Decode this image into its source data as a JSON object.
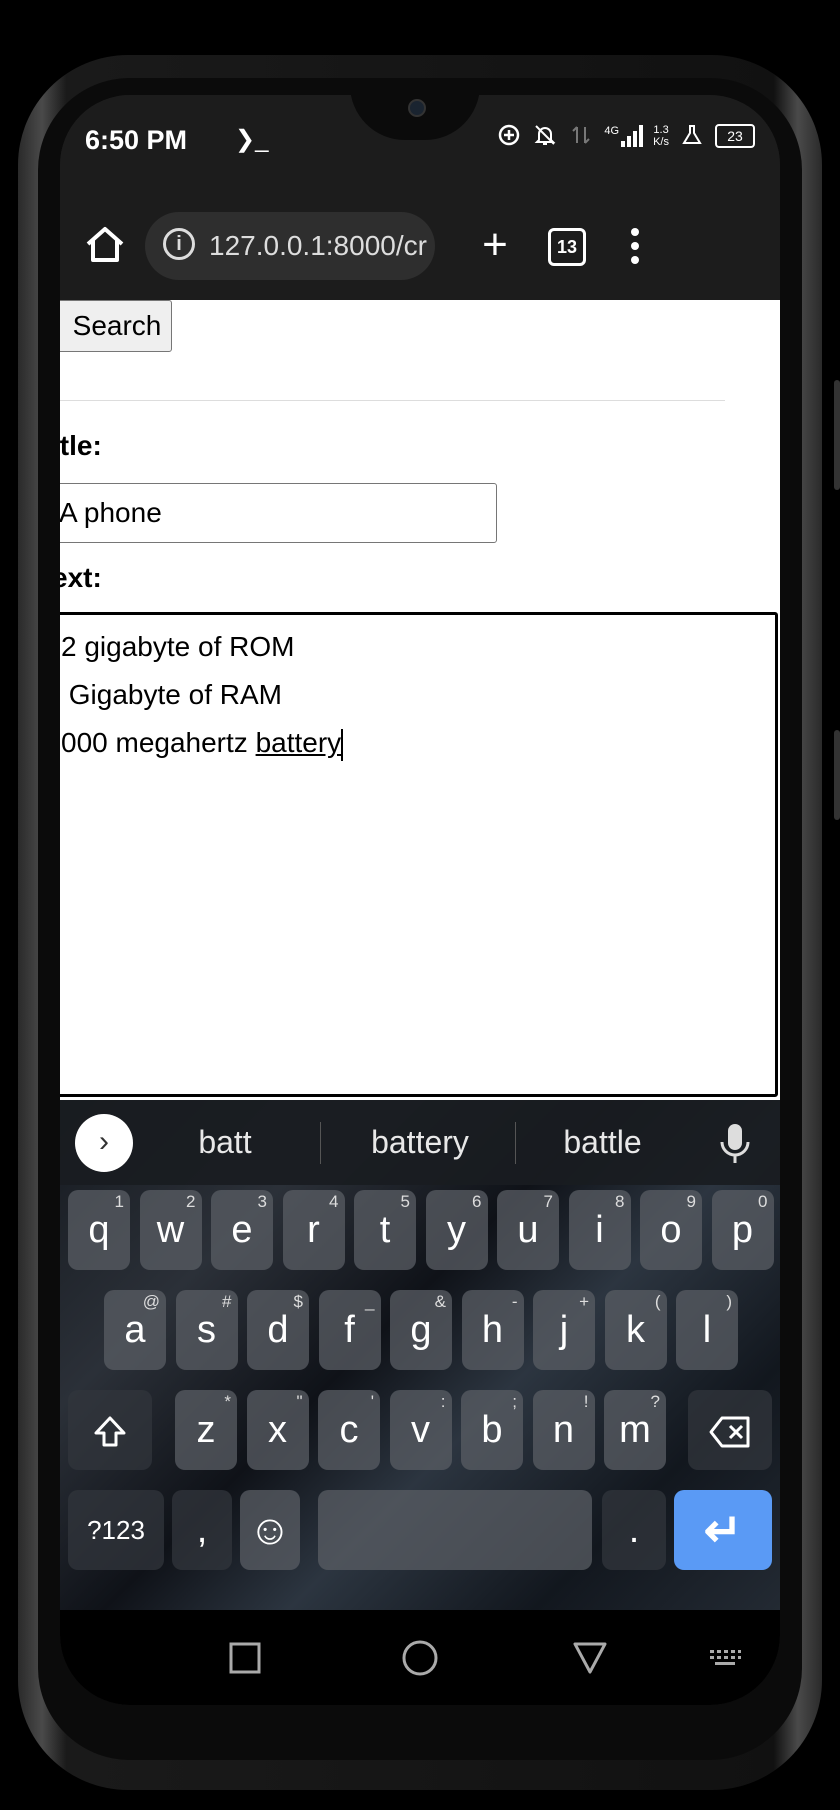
{
  "status_bar": {
    "time": "6:50 PM",
    "terminal_glyph": "❯_",
    "network_type": "4G",
    "net_speed_value": "1.3",
    "net_speed_unit": "K/s",
    "battery_level": "23"
  },
  "browser": {
    "url": "127.0.0.1:8000/cr",
    "tab_count": "13",
    "new_tab_glyph": "+",
    "menu_glyph": "⋮",
    "info_glyph": "i"
  },
  "page": {
    "search_button": "Search",
    "title_label": "itle:",
    "title_value": "A phone",
    "text_label": "ext:",
    "text_lines": [
      "2 gigabyte of ROM",
      " Gigabyte of RAM",
      "000 megahertz "
    ],
    "text_underlined_word": "battery"
  },
  "keyboard": {
    "expand_glyph": "›",
    "suggestions": [
      "batt",
      "battery",
      "battle"
    ],
    "row1": [
      {
        "key": "q",
        "hint": "1"
      },
      {
        "key": "w",
        "hint": "2"
      },
      {
        "key": "e",
        "hint": "3"
      },
      {
        "key": "r",
        "hint": "4"
      },
      {
        "key": "t",
        "hint": "5"
      },
      {
        "key": "y",
        "hint": "6"
      },
      {
        "key": "u",
        "hint": "7"
      },
      {
        "key": "i",
        "hint": "8"
      },
      {
        "key": "o",
        "hint": "9"
      },
      {
        "key": "p",
        "hint": "0"
      }
    ],
    "row2": [
      {
        "key": "a",
        "hint": "@"
      },
      {
        "key": "s",
        "hint": "#"
      },
      {
        "key": "d",
        "hint": "$"
      },
      {
        "key": "f",
        "hint": "_"
      },
      {
        "key": "g",
        "hint": "&"
      },
      {
        "key": "h",
        "hint": "-"
      },
      {
        "key": "j",
        "hint": "+"
      },
      {
        "key": "k",
        "hint": "("
      },
      {
        "key": "l",
        "hint": ")"
      }
    ],
    "row3": [
      {
        "key": "z",
        "hint": "*"
      },
      {
        "key": "x",
        "hint": "\""
      },
      {
        "key": "c",
        "hint": "'"
      },
      {
        "key": "v",
        "hint": ":"
      },
      {
        "key": "b",
        "hint": ";"
      },
      {
        "key": "n",
        "hint": "!"
      },
      {
        "key": "m",
        "hint": "?"
      }
    ],
    "symbols_key": "?123",
    "comma_key": ",",
    "period_key": ".",
    "space_key": "",
    "emoji_glyph": "☺",
    "enter_glyph": "↵"
  },
  "colors": {
    "enter_key": "#5a9af5",
    "toolbar_bg": "#1c1c1c",
    "page_bg": "#ffffff"
  }
}
